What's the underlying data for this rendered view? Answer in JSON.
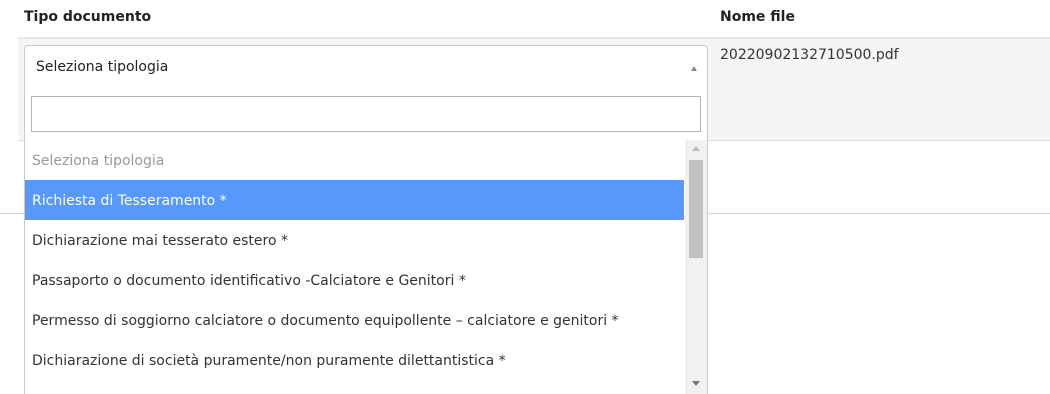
{
  "table": {
    "headers": {
      "tipo_documento": "Tipo documento",
      "nome_file": "Nome file"
    },
    "row": {
      "file_name": "20220902132710500.pdf"
    }
  },
  "select": {
    "value": "Seleziona tipologia",
    "search_value": ""
  },
  "dropdown": {
    "options": [
      {
        "label": "Seleziona tipologia",
        "state": "placeholder"
      },
      {
        "label": "Richiesta di Tesseramento *",
        "state": "highlighted"
      },
      {
        "label": "Dichiarazione mai tesserato estero *",
        "state": "normal"
      },
      {
        "label": "Passaporto o documento identificativo -Calciatore e Genitori *",
        "state": "normal"
      },
      {
        "label": "Permesso di soggiorno calciatore o documento equipollente – calciatore e genitori *",
        "state": "normal"
      },
      {
        "label": "Dichiarazione di società puramente/non puramente dilettantistica *",
        "state": "normal"
      }
    ]
  },
  "colors": {
    "highlight": "#5897fb",
    "placeholder_text": "#999999",
    "row_background": "#f5f5f5"
  }
}
